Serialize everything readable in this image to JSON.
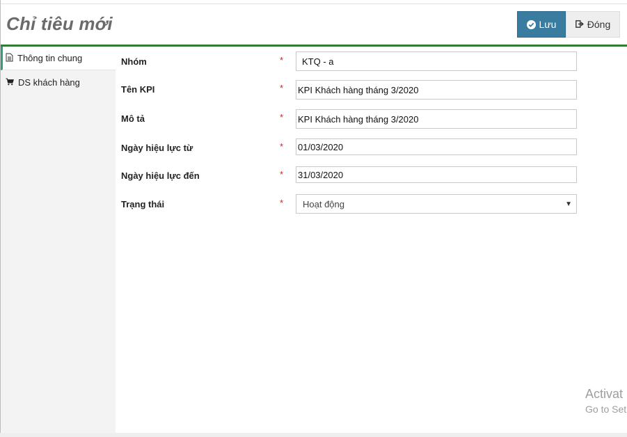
{
  "header": {
    "title": "Chỉ tiêu mới",
    "save_label": "Lưu",
    "close_label": "Đóng"
  },
  "sidebar": {
    "items": [
      {
        "label": "Thông tin chung",
        "icon": "document-icon",
        "active": true
      },
      {
        "label": "DS khách hàng",
        "icon": "cart-icon",
        "active": false
      }
    ]
  },
  "form": {
    "group": {
      "label": "Nhóm",
      "required": "*",
      "value": "KTQ - a"
    },
    "kpi_name": {
      "label": "Tên KPI",
      "required": "*",
      "value": "KPI Khách hàng tháng 3/2020"
    },
    "description": {
      "label": "Mô tả",
      "required": "*",
      "value": "KPI Khách hàng tháng 3/2020"
    },
    "valid_from": {
      "label": "Ngày hiệu lực từ",
      "required": "*",
      "value": "01/03/2020"
    },
    "valid_to": {
      "label": "Ngày hiệu lực đến",
      "required": "*",
      "value": "31/03/2020"
    },
    "status": {
      "label": "Trạng thái",
      "required": "*",
      "value": "Hoạt động"
    }
  },
  "watermark": {
    "line1": "Activat",
    "line2": "Go to Set"
  },
  "colors": {
    "accent_green": "#2e7d32",
    "save_button": "#3a7ba0",
    "required": "#c62828"
  }
}
